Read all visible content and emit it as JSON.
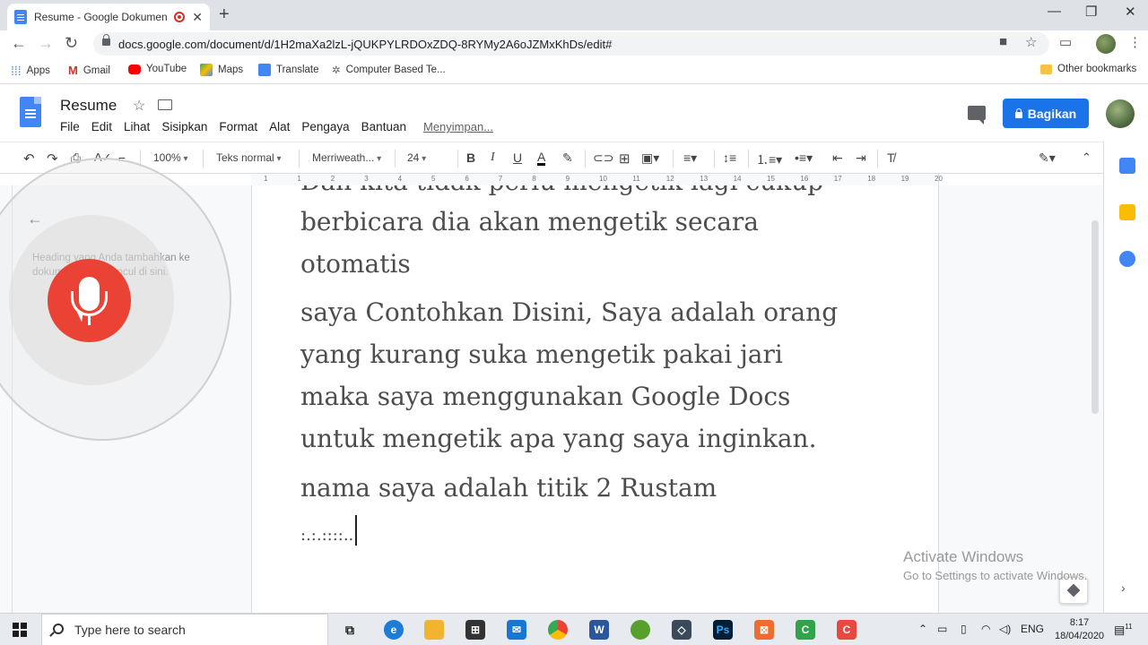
{
  "browser": {
    "tab_title": "Resume - Google Dokumen",
    "new_tab": "+",
    "url": "docs.google.com/document/d/1H2maXa2lzL-jQUKPYLRDOxZDQ-8RYMy2A6oJZMxKhDs/edit#",
    "bookmarks": [
      "Apps",
      "Gmail",
      "YouTube",
      "Maps",
      "Translate",
      "Computer Based Te..."
    ],
    "other_bookmarks": "Other bookmarks"
  },
  "docs": {
    "title": "Resume",
    "menu": [
      "File",
      "Edit",
      "Lihat",
      "Sisipkan",
      "Format",
      "Alat",
      "Pengaya",
      "Bantuan"
    ],
    "saving": "Menyimpan...",
    "share_label": "Bagikan"
  },
  "toolbar": {
    "zoom": "100%",
    "style": "Teks normal",
    "font": "Merriweath...",
    "size": "24",
    "bold": "B",
    "italic": "I",
    "underline": "U",
    "text_color": "A"
  },
  "ruler": {
    "marks": [
      "1",
      "1",
      "2",
      "3",
      "4",
      "5",
      "6",
      "7",
      "8",
      "9",
      "10",
      "11",
      "12",
      "13",
      "14",
      "15",
      "16",
      "17",
      "18",
      "19",
      "20"
    ]
  },
  "outline": {
    "hint": "Heading yang Anda tambahkan ke dokumen akan muncul di sini."
  },
  "document": {
    "lines": [
      "Dan kita tidak perlu mengetik lagi cukup",
      "berbicara dia akan mengetik secara",
      "otomatis",
      "saya Contohkan Disini, Saya adalah orang",
      "yang kurang suka mengetik pakai jari",
      "maka saya menggunakan Google Docs",
      "untuk mengetik apa yang saya inginkan.",
      "nama saya adalah titik 2 Rustam",
      ":.:.::::.."
    ]
  },
  "watermark": {
    "line1": "Activate Windows",
    "line2": "Go to Settings to activate Windows."
  },
  "taskbar": {
    "search_placeholder": "Type here to search",
    "language": "ENG",
    "time": "8:17",
    "date": "18/04/2020",
    "notification_count": "11"
  }
}
